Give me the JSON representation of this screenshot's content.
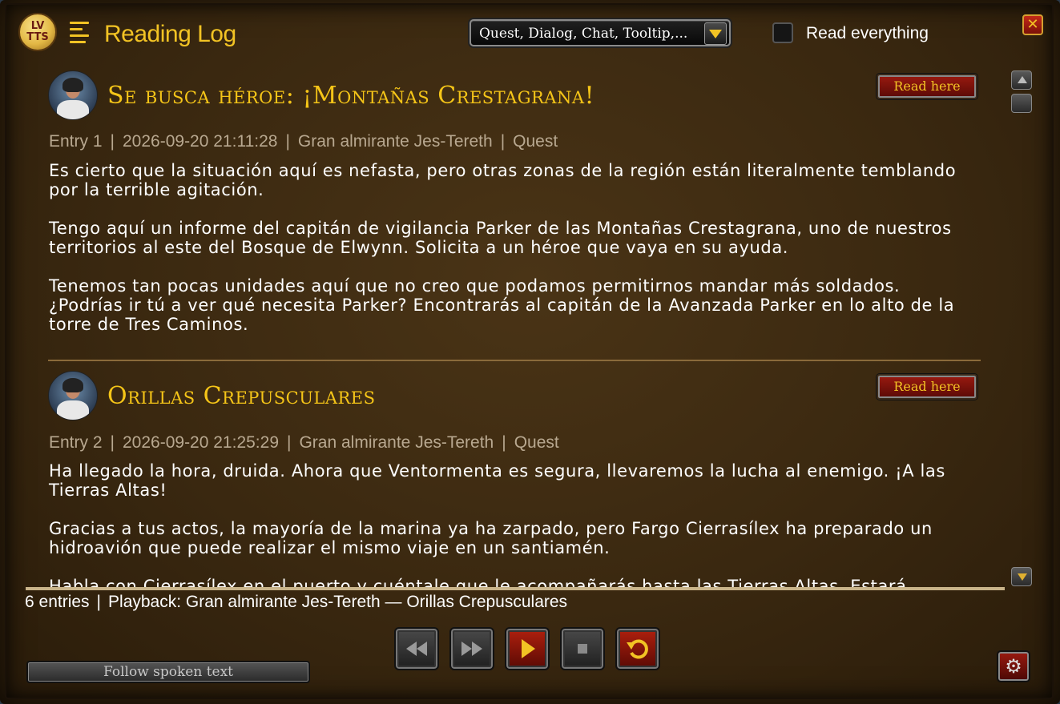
{
  "header": {
    "logo_line1": "LV",
    "logo_line2": "TTS",
    "title": "Reading Log",
    "filter_value": "Quest, Dialog, Chat, Tooltip,...",
    "read_everything_label": "Read everything",
    "read_everything_checked": false,
    "close_glyph": "✕"
  },
  "entries": [
    {
      "title": "Se busca héroe: ¡Montañas Crestagrana!",
      "read_button": "Read here",
      "entry_label": "Entry 1",
      "timestamp": "2026-09-20 21:11:28",
      "speaker": "Gran almirante Jes-Tereth",
      "type": "Quest",
      "paragraphs": [
        "Es cierto que la situación aquí es nefasta, pero otras zonas de la región están literalmente temblando por la terrible agitación.",
        "Tengo aquí un informe del capitán de vigilancia Parker de las Montañas Crestagrana, uno de nuestros territorios al este del Bosque de Elwynn. Solicita a un héroe que vaya en su ayuda.",
        "Tenemos tan pocas unidades aquí que no creo que podamos permitirnos mandar más soldados. ¿Podrías ir tú a ver qué necesita Parker? Encontrarás al capitán de la Avanzada Parker en lo alto de la torre de Tres Caminos."
      ]
    },
    {
      "title": "Orillas Crepusculares",
      "read_button": "Read here",
      "entry_label": "Entry 2",
      "timestamp": "2026-09-20 21:25:29",
      "speaker": "Gran almirante Jes-Tereth",
      "type": "Quest",
      "paragraphs": [
        "Ha llegado la hora, druida. Ahora que Ventormenta es segura, llevaremos la lucha al enemigo. ¡A las Tierras Altas!",
        "Gracias a tus actos, la mayoría de la marina ya ha zarpado, pero Fargo Cierrasílex ha preparado un hidroavión que puede realizar el mismo viaje en un santiamén.",
        "Habla con Cierrasílex en el puerto y cuéntale que le acompañarás hasta las Tierras Altas. Estará"
      ]
    }
  ],
  "meta_separator": "|",
  "status": {
    "count": "6 entries",
    "separator": "|",
    "playback": "Playback: Gran almirante Jes-Tereth — Orillas Crepusculares"
  },
  "controls": {
    "follow_label": "Follow spoken text",
    "buttons": [
      "rewind-icon",
      "fast-forward-icon",
      "play-icon",
      "stop-icon",
      "repeat-icon"
    ]
  },
  "colors": {
    "accent_gold": "#f2c324",
    "title_gold": "#f5c518",
    "button_red": "#9a1a10",
    "meta_text": "#b8a890",
    "parchment": "#3a2810"
  }
}
